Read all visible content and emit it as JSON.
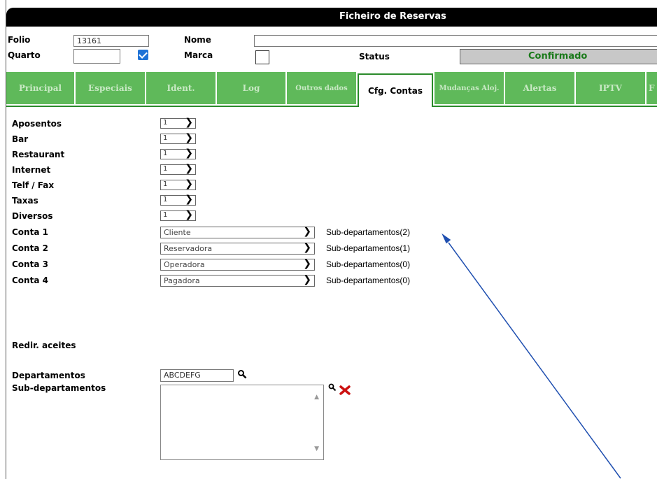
{
  "window": {
    "title": "Ficheiro de Reservas"
  },
  "header": {
    "folio_label": "Folio",
    "folio_value": "13161",
    "nome_label": "Nome",
    "nome_value": "",
    "quarto_label": "Quarto",
    "quarto_value": "",
    "quarto_checked": true,
    "marca_label": "Marca",
    "marca_checked": false,
    "status_label": "Status",
    "status_value": "Confirmado"
  },
  "tabs": [
    {
      "label": "Principal",
      "active": false
    },
    {
      "label": "Especiais",
      "active": false
    },
    {
      "label": "Ident.",
      "active": false
    },
    {
      "label": "Log",
      "active": false
    },
    {
      "label": "Outros dados",
      "active": false
    },
    {
      "label": "Cfg. Contas",
      "active": true
    },
    {
      "label": "Mudanças Aloj.",
      "active": false
    },
    {
      "label": "Alertas",
      "active": false
    },
    {
      "label": "IPTV",
      "active": false
    },
    {
      "label": "F",
      "active": false
    }
  ],
  "config": {
    "rows": [
      {
        "label": "Aposentos",
        "value": "1"
      },
      {
        "label": "Bar",
        "value": "1"
      },
      {
        "label": "Restaurant",
        "value": "1"
      },
      {
        "label": "Internet",
        "value": "1"
      },
      {
        "label": "Telf / Fax",
        "value": "1"
      },
      {
        "label": "Taxas",
        "value": "1"
      },
      {
        "label": "Diversos",
        "value": "1"
      }
    ],
    "accounts": [
      {
        "label": "Conta 1",
        "value": "Cliente",
        "link": "Sub-departamentos(2)"
      },
      {
        "label": "Conta 2",
        "value": "Reservadora",
        "link": "Sub-departamentos(1)"
      },
      {
        "label": "Conta 3",
        "value": "Operadora",
        "link": "Sub-departamentos(0)"
      },
      {
        "label": "Conta 4",
        "value": "Pagadora",
        "link": "Sub-departamentos(0)"
      }
    ],
    "redir_label": "Redir. aceites",
    "departamentos_label": "Departamentos",
    "departamentos_value": "ABCDEFG",
    "subdepartamentos_label": "Sub-departamentos"
  },
  "colors": {
    "tab_green": "#5fb95a",
    "status_text": "#1a7a1a",
    "checkbox_blue": "#1e72d6",
    "arrow": "#1f4fb0",
    "delete_red": "#cc1111"
  },
  "icons": {
    "search": "search-icon",
    "delete": "delete-icon",
    "dropdown": "chevron-down-icon"
  }
}
